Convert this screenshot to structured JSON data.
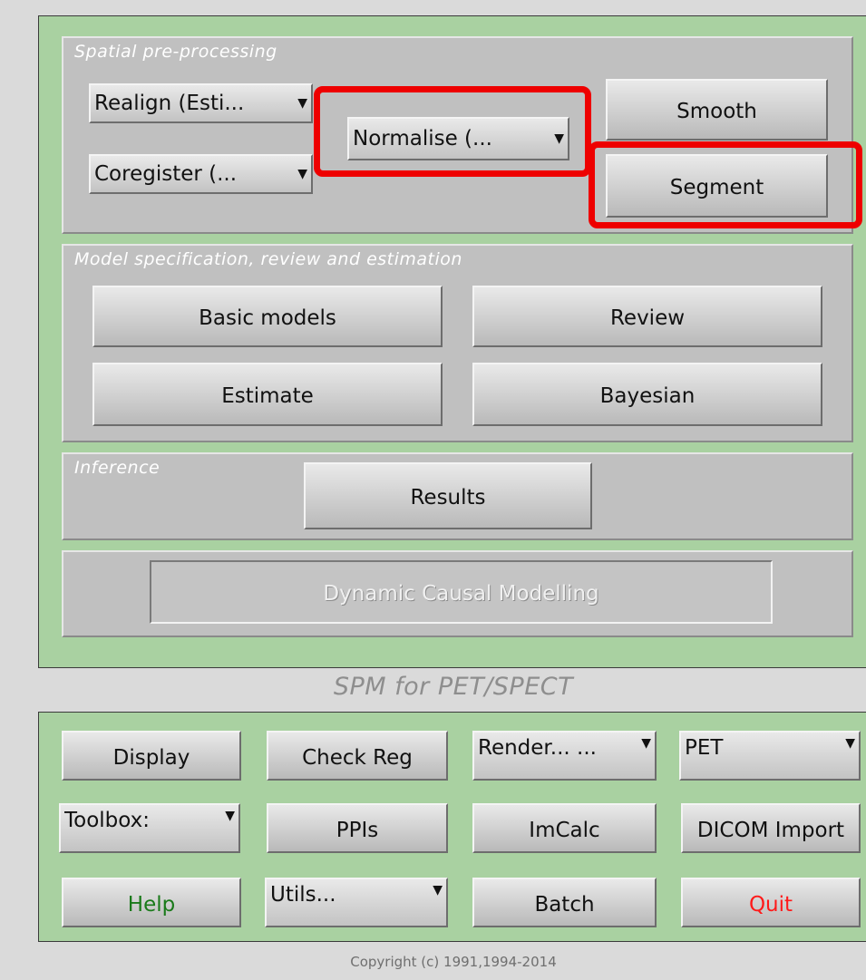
{
  "spatial": {
    "title": "Spatial pre-processing",
    "realign": "Realign (Esti...",
    "coregister": "Coregister (...",
    "normalise": "Normalise (...",
    "smooth": "Smooth",
    "segment": "Segment"
  },
  "model": {
    "title": "Model specification, review and estimation",
    "basic_models": "Basic models",
    "review": "Review",
    "estimate": "Estimate",
    "bayesian": "Bayesian"
  },
  "inference": {
    "title": "Inference",
    "results": "Results"
  },
  "dcm": {
    "label": "Dynamic Causal Modelling"
  },
  "app_subtitle": "SPM for PET/SPECT",
  "utilities": {
    "display": "Display",
    "check_reg": "Check Reg",
    "render": "Render...  ...",
    "modality": "PET",
    "toolbox": "Toolbox:",
    "ppis": "PPIs",
    "imcalc": "ImCalc",
    "dicom_import": "DICOM Import",
    "help": "Help",
    "utils": "Utils...",
    "batch": "Batch",
    "quit": "Quit"
  },
  "copyright": "Copyright (c) 1991,1994-2014",
  "colors": {
    "help_text": "#1a7a1a",
    "quit_text": "#ff1a1a",
    "highlight": "#ee0000",
    "frame_green": "#a9d1a1"
  }
}
